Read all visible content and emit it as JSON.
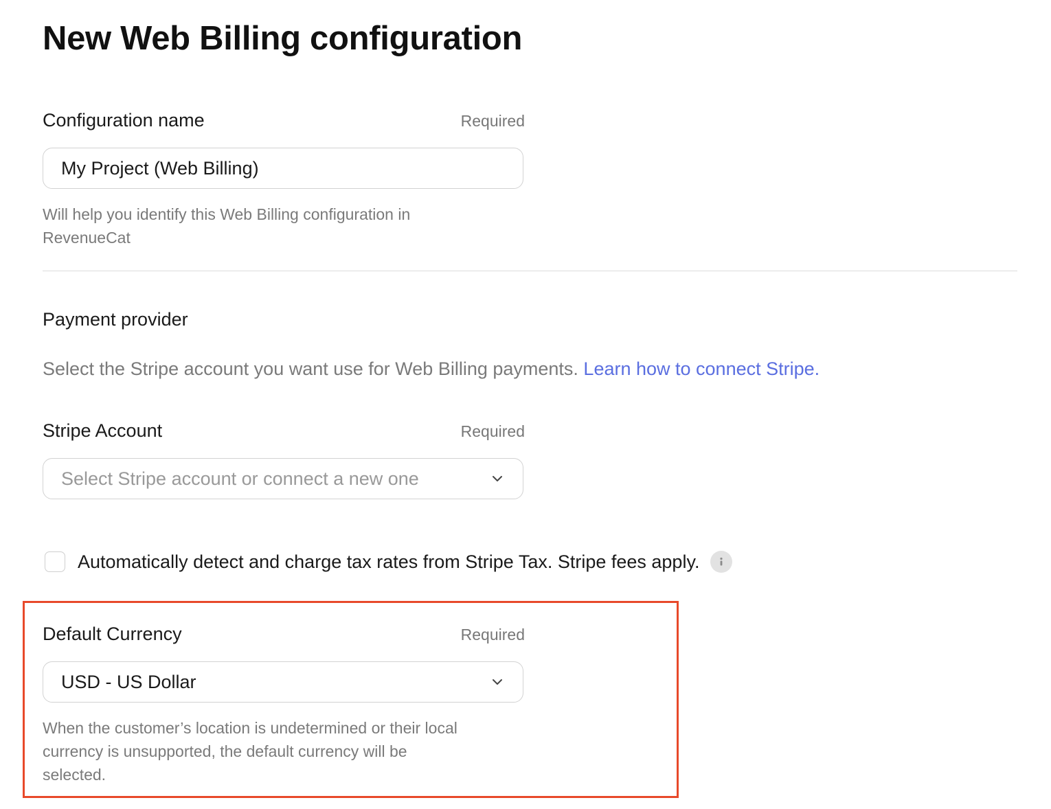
{
  "page": {
    "title": "New Web Billing configuration"
  },
  "config_name": {
    "label": "Configuration name",
    "required": "Required",
    "value": "My Project (Web Billing)",
    "hint_line1": "Will help you identify this Web Billing configuration in",
    "hint_line2": "RevenueCat"
  },
  "payment_provider": {
    "title": "Payment provider",
    "description": "Select the Stripe account you want use for Web Billing payments. ",
    "link_text": "Learn how to connect Stripe."
  },
  "stripe_account": {
    "label": "Stripe Account",
    "required": "Required",
    "placeholder": "Select Stripe account or connect a new one",
    "icon": "chevron-down-icon"
  },
  "tax": {
    "checked": false,
    "label": "Automatically detect and charge tax rates from Stripe Tax. Stripe fees apply.",
    "icon": "info-icon"
  },
  "default_currency": {
    "label": "Default Currency",
    "required": "Required",
    "value": "USD - US Dollar",
    "icon": "chevron-down-icon",
    "hint_line1": "When the customer’s location is undetermined or their local",
    "hint_line2": "currency is unsupported, the default currency will be",
    "hint_line3": "selected."
  },
  "colors": {
    "link": "#5a6ee0",
    "highlight_border": "#e8492a"
  }
}
